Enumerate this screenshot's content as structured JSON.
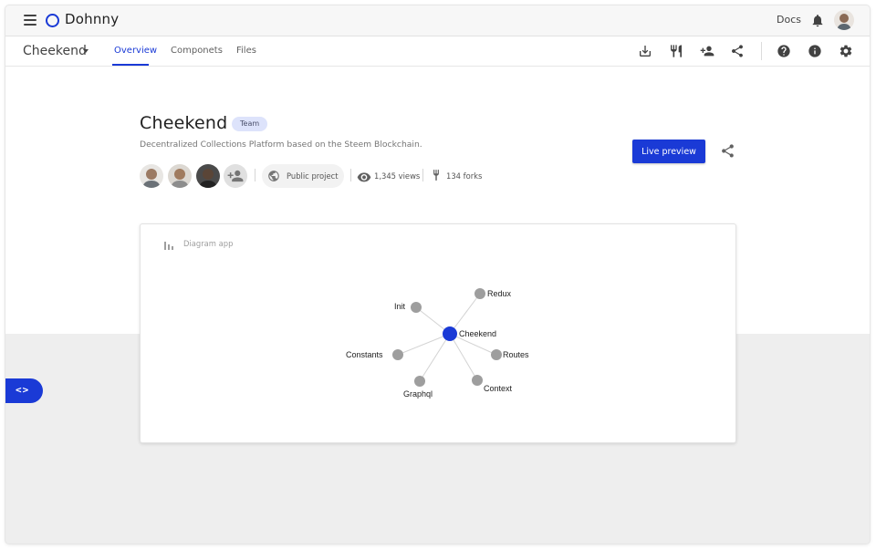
{
  "topbar": {
    "app_name": "Dohnny",
    "docs_label": "Docs",
    "menu_icon": "hamburger-menu-icon",
    "logo_icon": "circle-logo-icon",
    "notifications_icon": "bell-icon"
  },
  "project": {
    "name": "Cheekend",
    "tabs": [
      {
        "label": "Overview",
        "active": true
      },
      {
        "label": "Componets",
        "active": false
      },
      {
        "label": "Files",
        "active": false
      }
    ],
    "toolbar_icons": [
      "download-icon",
      "fork-icon",
      "add-person-icon",
      "share-icon",
      "help-icon",
      "info-icon",
      "settings-icon"
    ]
  },
  "hero": {
    "title": "Cheekend",
    "badge": "Team",
    "description": "Decentralized Collections Platform based on the Steem Blockchain.",
    "visibility": "Public project",
    "views": "1,345 views",
    "forks": "134 forks",
    "live_preview_label": "Live preview"
  },
  "diagram": {
    "title": "Diagram app",
    "center": "Cheekend",
    "nodes": [
      "Redux",
      "Init",
      "Routes",
      "Constants",
      "Context",
      "Graphql"
    ]
  },
  "colors": {
    "accent": "#1a3ad6",
    "badge_bg": "#dde3fb",
    "node_gray": "#9e9e9e"
  },
  "side_toggle_label": "<>"
}
